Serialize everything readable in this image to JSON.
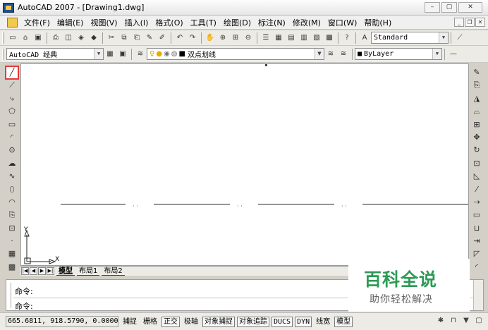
{
  "window": {
    "title": "AutoCAD 2007 - [Drawing1.dwg]",
    "controls": {
      "minimize": "–",
      "maximize": "▢",
      "close": "✕"
    }
  },
  "menu": {
    "items": [
      "文件(F)",
      "编辑(E)",
      "视图(V)",
      "插入(I)",
      "格式(O)",
      "工具(T)",
      "绘图(D)",
      "标注(N)",
      "修改(M)",
      "窗口(W)",
      "帮助(H)"
    ],
    "mdi_controls": {
      "minimize": "_",
      "restore": "❐",
      "close": "✕"
    }
  },
  "toolbar_standard": {
    "text_style_combo": "Standard"
  },
  "toolbar_workspace": {
    "workspace_combo": "AutoCAD 经典",
    "layer_combo": "双点划线",
    "color_combo": "ByLayer"
  },
  "drawing_tabs": {
    "nav_first": "|◀",
    "nav_prev": "◀",
    "nav_next": "▶",
    "nav_last": "▶|",
    "tabs": [
      "模型",
      "布局1",
      "布局2"
    ]
  },
  "ucs": {
    "y_label": "Y",
    "x_label": "X"
  },
  "command": {
    "line1": "命令:",
    "line2": "命令:"
  },
  "watermark": {
    "title": "百科全说",
    "subtitle": "助你轻松解决"
  },
  "status": {
    "coordinates": "665.6811, 918.5790, 0.0000",
    "buttons": [
      "捕捉",
      "栅格",
      "正交",
      "极轴",
      "对象捕捉",
      "对象追踪",
      "DUCS",
      "DYN",
      "线宽",
      "模型"
    ],
    "pressed": [
      false,
      false,
      true,
      false,
      true,
      true,
      true,
      true,
      false,
      true
    ]
  },
  "colors": {
    "selection_outline": "#e43a3a",
    "watermark_green": "#2c9a55"
  }
}
